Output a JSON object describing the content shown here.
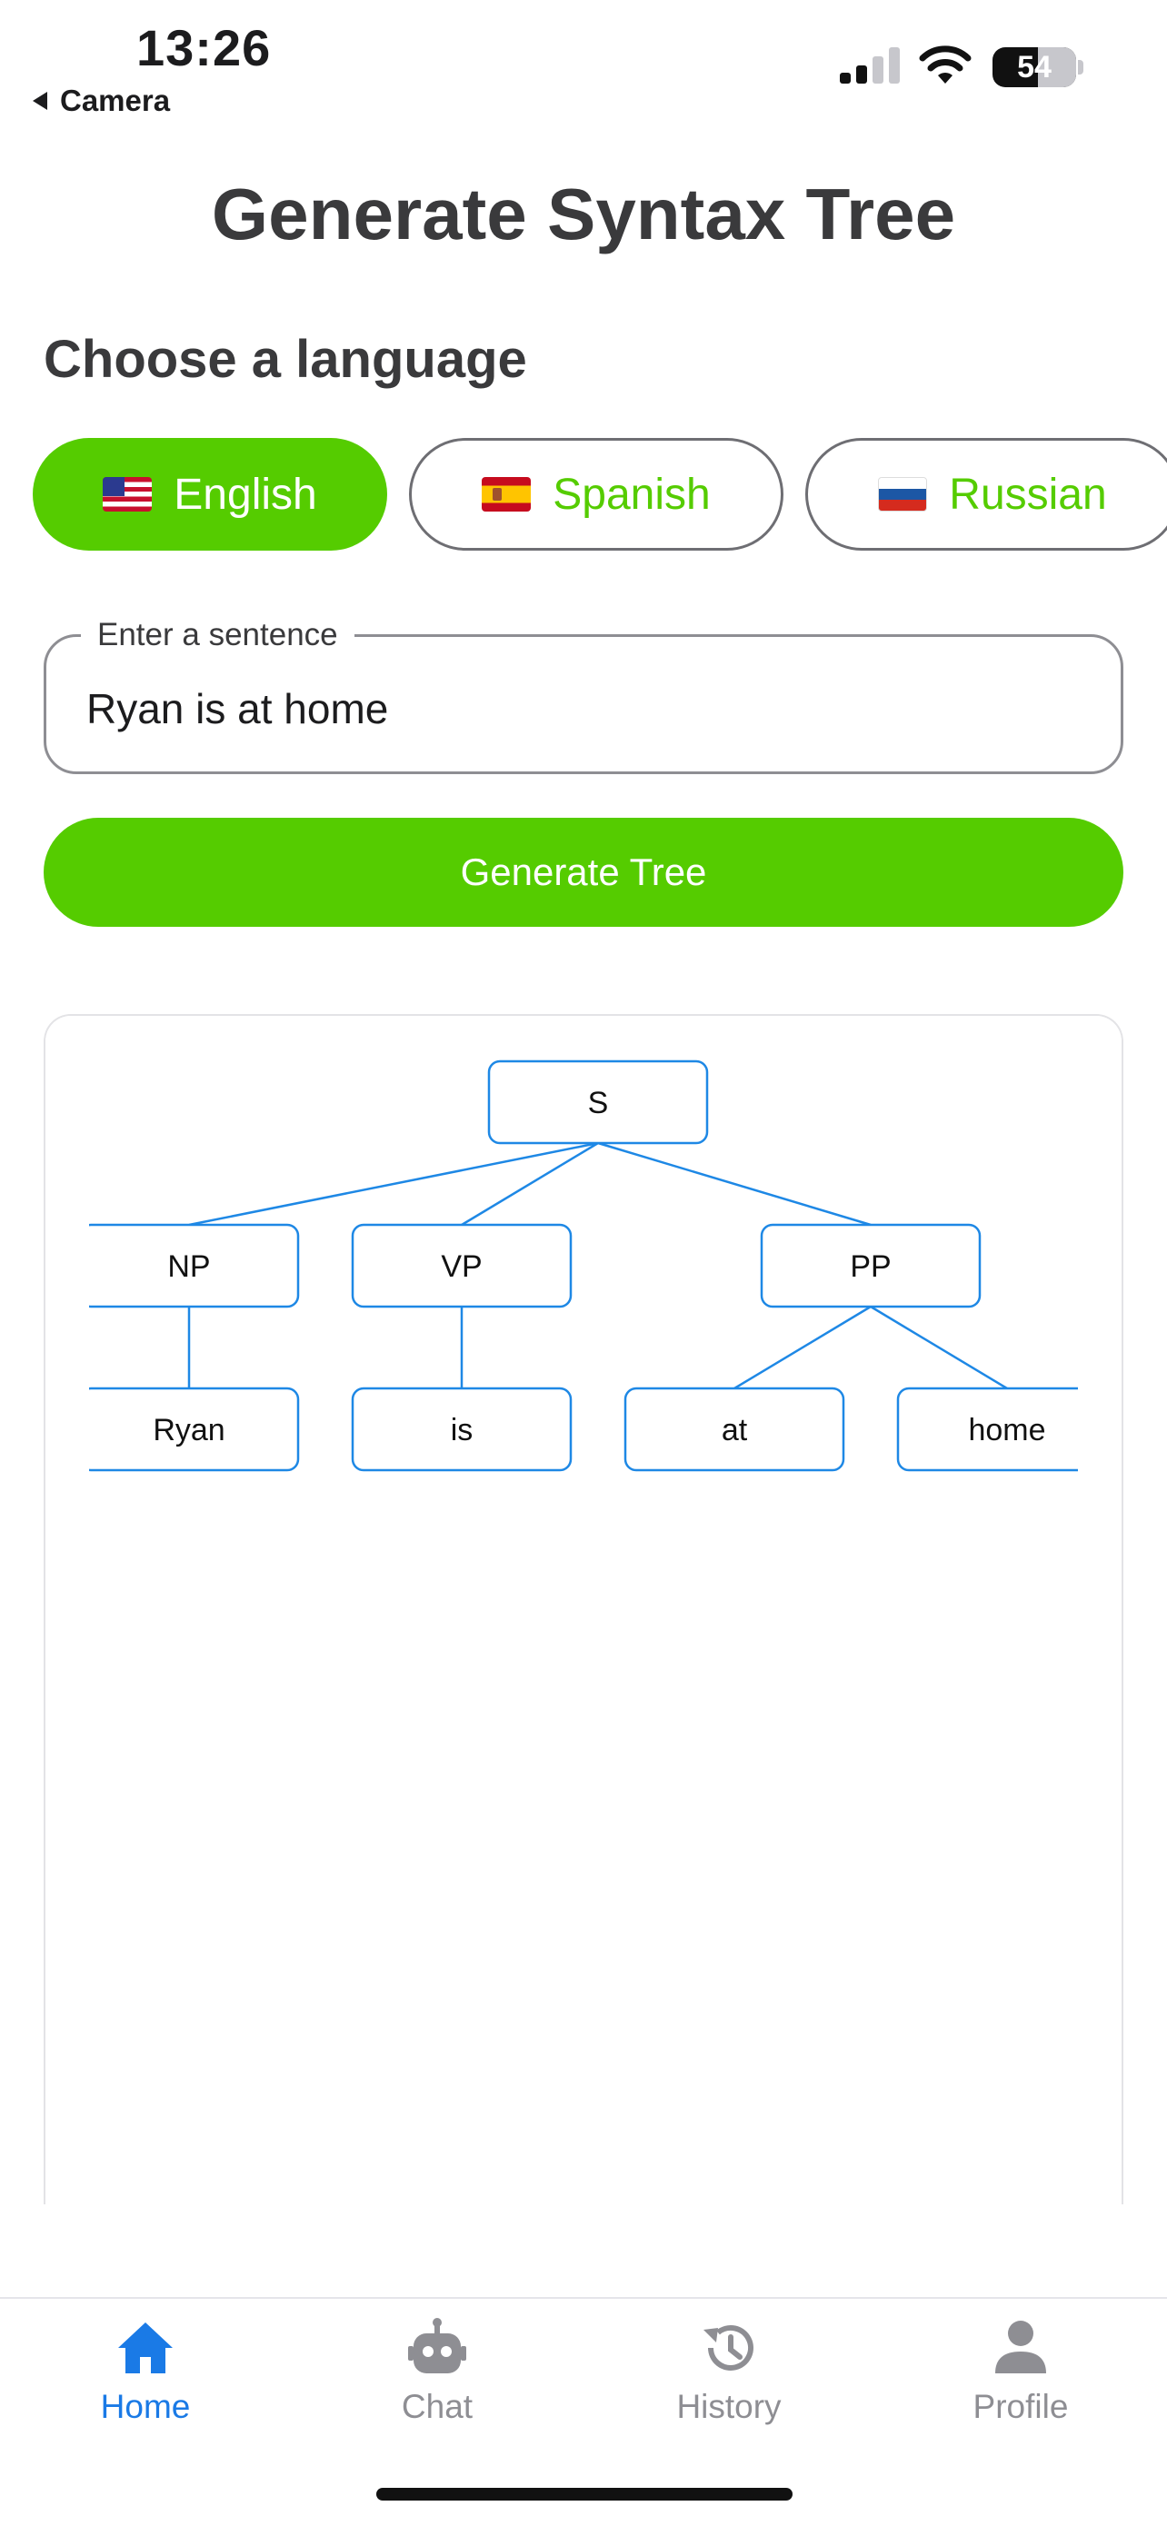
{
  "status_bar": {
    "time": "13:26",
    "back_label": "Camera",
    "battery": "54"
  },
  "page_title": "Generate Syntax Tree",
  "language_section": {
    "label": "Choose a language",
    "options": [
      {
        "label": "English",
        "flag": "us-flag",
        "selected": true
      },
      {
        "label": "Spanish",
        "flag": "spain-flag",
        "selected": false
      },
      {
        "label": "Russian",
        "flag": "russia-flag",
        "selected": false
      }
    ]
  },
  "sentence_field": {
    "legend": "Enter a sentence",
    "value": "Ryan is at home"
  },
  "generate_button": "Generate Tree",
  "syntax_tree": {
    "nodes": [
      "S",
      "NP",
      "VP",
      "PP",
      "Ryan",
      "is",
      "at",
      "home"
    ],
    "edges": [
      [
        "S",
        "NP"
      ],
      [
        "S",
        "VP"
      ],
      [
        "S",
        "PP"
      ],
      [
        "NP",
        "Ryan"
      ],
      [
        "VP",
        "is"
      ],
      [
        "PP",
        "at"
      ],
      [
        "PP",
        "home"
      ]
    ]
  },
  "tab_bar": {
    "tabs": [
      {
        "label": "Home",
        "icon": "house-icon",
        "active": true
      },
      {
        "label": "Chat",
        "icon": "robot-icon",
        "active": false
      },
      {
        "label": "History",
        "icon": "history-icon",
        "active": false
      },
      {
        "label": "Profile",
        "icon": "person-icon",
        "active": false
      }
    ]
  },
  "colors": {
    "accent_green": "#55cc00",
    "tab_active_blue": "#1a7ae6",
    "tree_blue": "#1e88e5"
  }
}
